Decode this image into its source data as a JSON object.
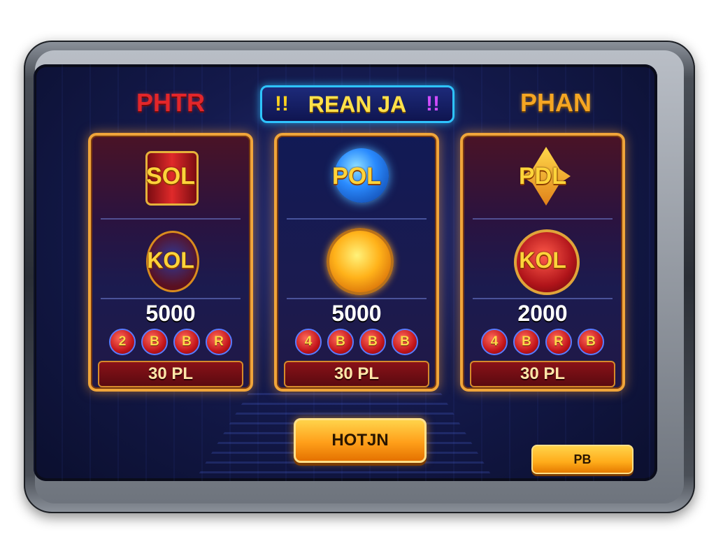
{
  "header": {
    "left_label": "PHTR",
    "right_label": "PHAN",
    "title": "REAN JA",
    "title_left_mark": "!!",
    "title_right_mark": "!!"
  },
  "cards": [
    {
      "top_emblem": "SOL",
      "mid_emblem": "KOL",
      "amount": "5000",
      "balls": [
        "2",
        "B",
        "B",
        "R"
      ],
      "price": "30 PL"
    },
    {
      "top_emblem": "POL",
      "mid_emblem": "",
      "amount": "5000",
      "balls": [
        "4",
        "B",
        "B",
        "B"
      ],
      "price": "30 PL"
    },
    {
      "top_emblem": "PDL",
      "mid_emblem": "KOL",
      "amount": "2000",
      "balls": [
        "4",
        "B",
        "R",
        "B"
      ],
      "price": "30 PL"
    }
  ],
  "buttons": {
    "main": "HOTJN",
    "secondary": "PB"
  },
  "colors": {
    "accent_gold": "#f0a53a",
    "title_border": "#2ec4ff",
    "left_header": "#e3262a",
    "right_header": "#f5a623"
  }
}
